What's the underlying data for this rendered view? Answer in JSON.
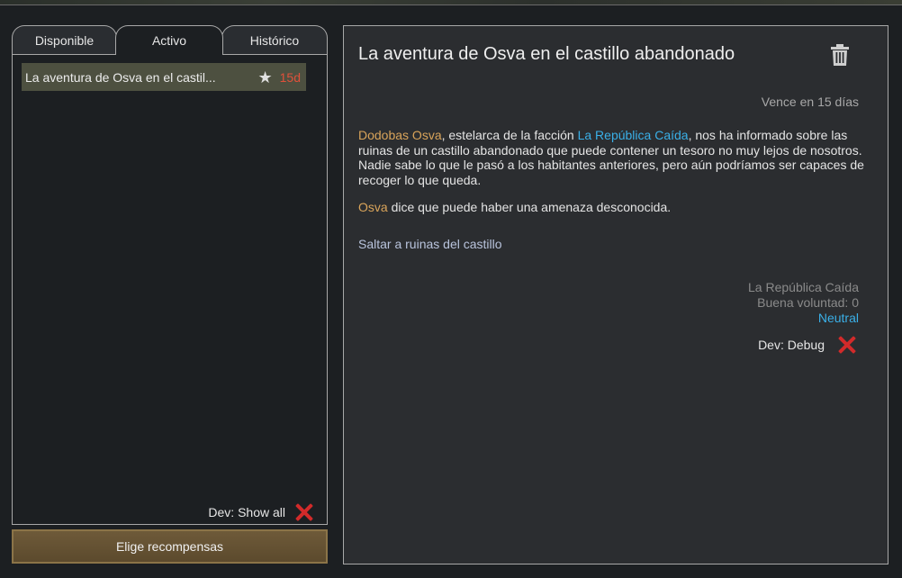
{
  "tabs": [
    {
      "label": "Disponible"
    },
    {
      "label": "Activo"
    },
    {
      "label": "Histórico"
    }
  ],
  "quest_list": [
    {
      "title": "La aventura de Osva en el castil...",
      "days": "15d",
      "star_icon": "star-icon"
    }
  ],
  "dev_show_all": "Dev: Show all",
  "reward_button": "Elige recompensas",
  "detail": {
    "title": "La aventura de Osva en el castillo abandonado",
    "due": "Vence en 15 días",
    "desc_person": "Dodobas Osva",
    "desc_text1": ", estelarca de la facción ",
    "desc_faction": "La República Caída",
    "desc_text2": ", nos ha informado sobre las ruinas de un castillo abandonado que puede contener un tesoro no muy lejos de nosotros. Nadie sabe lo que le pasó a los habitantes anteriores, pero aún podríamos ser capaces de recoger lo que queda.",
    "desc2_person": "Osva",
    "desc2_text": " dice que puede haber una amenaza desconocida.",
    "jump_link": "Saltar a ruinas del castillo",
    "faction_name": "La República Caída",
    "goodwill": "Buena voluntad: 0",
    "status": "Neutral",
    "dev_debug": "Dev: Debug"
  },
  "colors": {
    "person": "#d9a45a",
    "faction": "#3ab0e8",
    "days": "#e0503a",
    "close": "#d22a2a"
  }
}
